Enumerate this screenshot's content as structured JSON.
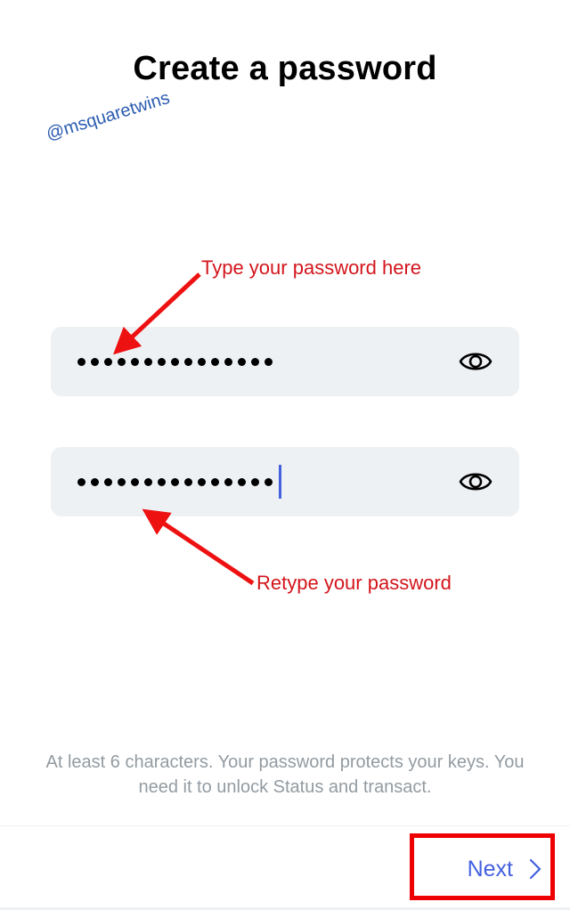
{
  "page": {
    "title": "Create a password",
    "watermark": "@msquaretwins"
  },
  "fields": [
    {
      "name": "password",
      "masked_length": 15,
      "focused": false,
      "toggle_icon": "eye-icon"
    },
    {
      "name": "confirm-password",
      "masked_length": 15,
      "focused": true,
      "toggle_icon": "eye-icon"
    }
  ],
  "annotations": {
    "type_hint": "Type your password here",
    "retype_hint": "Retype your password",
    "color": "#d3151c"
  },
  "hint_text": "At least 6 characters. Your password protects your keys. You need it to unlock Status and transact.",
  "footer": {
    "next_label": "Next",
    "next_icon": "chevron-right-icon"
  },
  "colors": {
    "accent": "#4360df",
    "field_bg": "#eef1f4",
    "hint": "#939ba1",
    "highlight": "#ee0000"
  }
}
